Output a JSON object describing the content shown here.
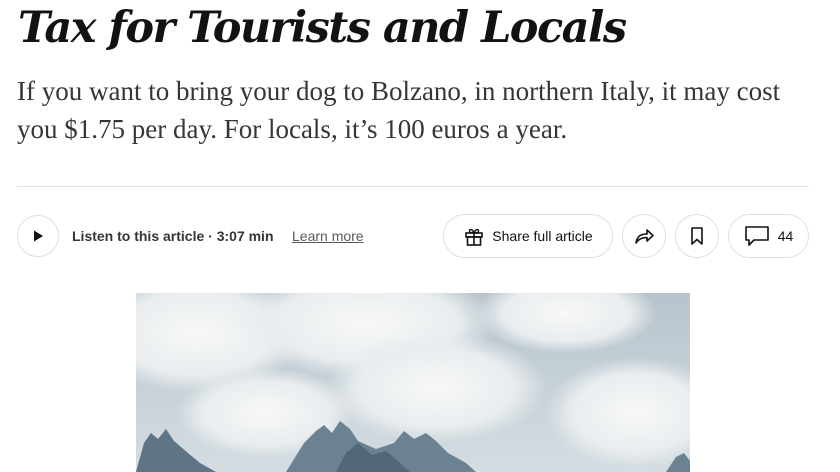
{
  "article": {
    "headline": "Tax for Tourists and Locals",
    "summary": "If you want to bring your dog to Bolzano, in northern Italy, it may cost you $1.75 per day. For locals, it’s 100 euros a year."
  },
  "toolbar": {
    "listen_label": "Listen to this article",
    "separator": " · ",
    "listen_duration": "3:07 min",
    "learn_more": "Learn more",
    "share_label": "Share full article",
    "comments_count": "44",
    "icons": {
      "play": "play-icon",
      "gift": "gift-icon",
      "forward": "forward-arrow-icon",
      "bookmark": "bookmark-icon",
      "comment": "comment-icon"
    }
  },
  "colors": {
    "headline": "#121212",
    "body_text": "#363636",
    "border": "#dfdfdf",
    "background": "#ffffff"
  }
}
